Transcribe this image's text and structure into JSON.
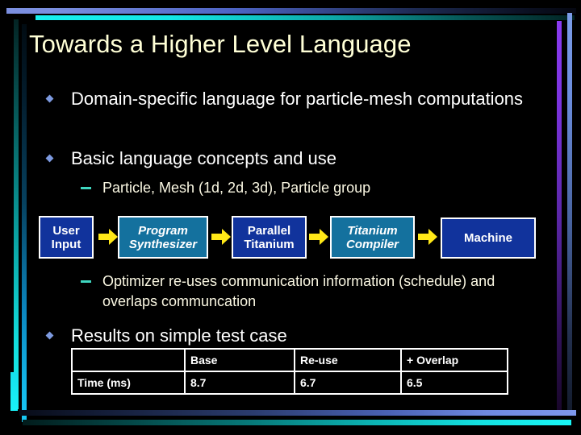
{
  "slide": {
    "title": "Towards a Higher Level Language",
    "bullets": [
      {
        "level": 1,
        "text": "Domain-specific language for particle-mesh computations"
      },
      {
        "level": 1,
        "text": "Basic language concepts and use"
      },
      {
        "level": 2,
        "text": "Particle, Mesh (1d, 2d, 3d), Particle group"
      },
      {
        "level": 2,
        "text": "Optimizer re-uses communication information (schedule) and overlaps communcation"
      },
      {
        "level": 1,
        "text": "Results on simple test case"
      }
    ],
    "colors": {
      "title_text": "#ffffd6",
      "body_text": "#ffffff",
      "sub_text": "#fbf8e3",
      "bullet_marker": "#7d9ae0",
      "dash_marker": "#3fd7c0",
      "arrow": "#ffe817",
      "box_navy": "#11339c",
      "box_teal": "#14719e",
      "background": "#000000"
    }
  },
  "flow": {
    "nodes": [
      {
        "label": "User Input",
        "style": "navy"
      },
      {
        "label": "Program Synthesizer",
        "style": "teal"
      },
      {
        "label": "Parallel Titanium",
        "style": "navy"
      },
      {
        "label": "Titanium Compiler",
        "style": "teal"
      },
      {
        "label": "Machine",
        "style": "navy"
      }
    ],
    "arrow_count": 4
  },
  "table": {
    "headers": [
      "",
      "Base",
      "Re-use",
      "+ Overlap"
    ],
    "rows": [
      {
        "label": "Time (ms)",
        "values": [
          "8.7",
          "6.7",
          "6.5"
        ]
      }
    ]
  }
}
